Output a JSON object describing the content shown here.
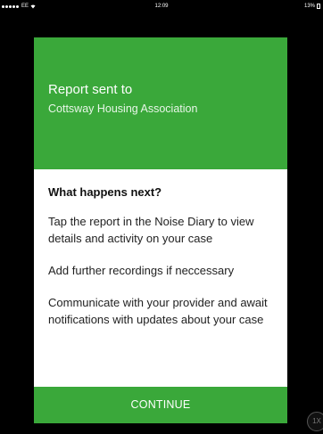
{
  "status_bar": {
    "carrier": "EE",
    "time": "12:09",
    "battery": "13%",
    "signal_dots": 5
  },
  "modal": {
    "title": "Report sent to",
    "recipient": "Cottsway Housing Association",
    "heading": "What happens next?",
    "steps": [
      "Tap the report in the Noise Diary to view details and activity on your case",
      "Add further recordings if neccessary",
      "Communicate with your provider and await notifications with updates about your case"
    ],
    "continue_label": "CONTINUE"
  },
  "zoom_badge": {
    "label": "1X"
  },
  "colors": {
    "brand_green": "#3aa83a",
    "background": "#000000",
    "card_body": "#ffffff"
  },
  "icons": {
    "wifi": "wifi-icon",
    "battery": "battery-icon"
  }
}
